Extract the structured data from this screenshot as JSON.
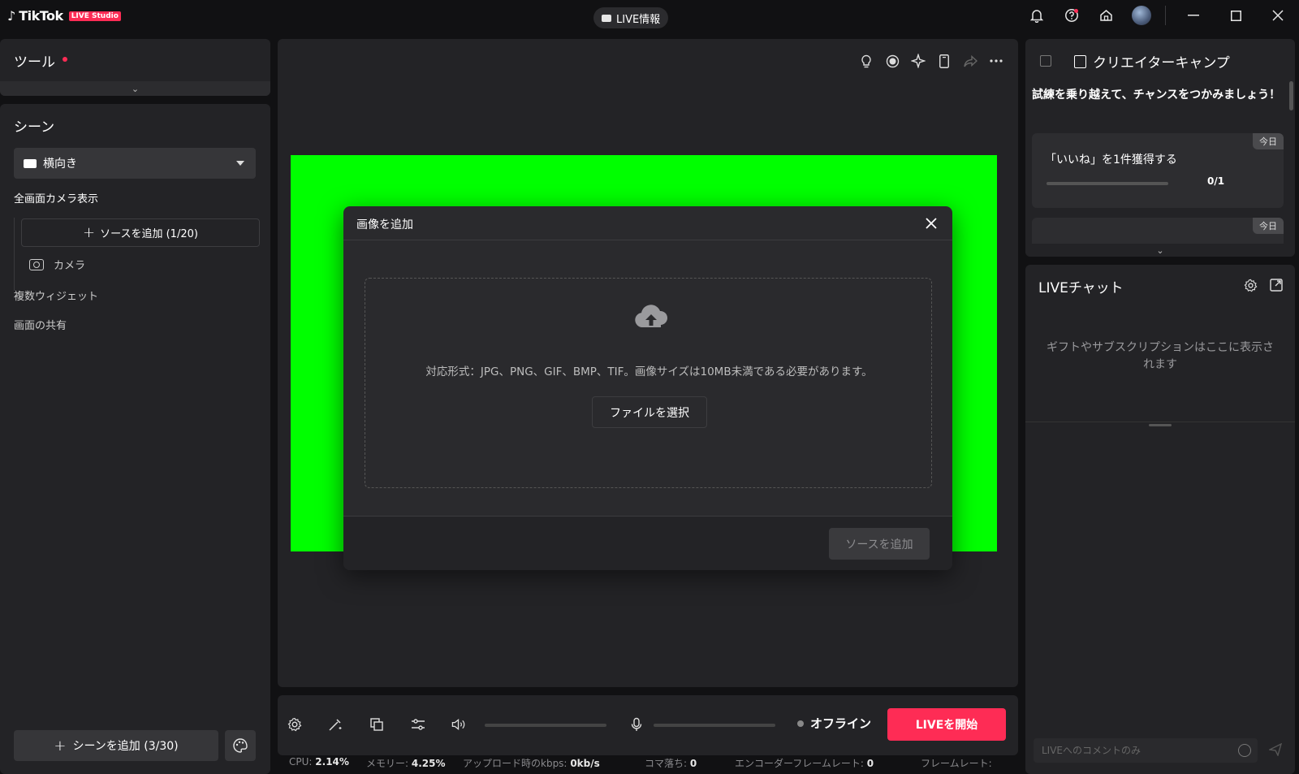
{
  "app": {
    "logo_text": "TikTok",
    "logo_badge": "LIVE Studio",
    "live_info_label": "LIVE情報"
  },
  "tools": {
    "title": "ツール"
  },
  "scenes": {
    "title": "シーン",
    "selected": "横向き",
    "group_label": "全画面カメラ表示",
    "add_source_label": "ソースを追加 (1/20)",
    "sources": [
      {
        "label": "カメラ",
        "icon": "camera-icon"
      }
    ],
    "links": [
      "複数ウィジェット",
      "画面の共有"
    ],
    "add_scene_label": "シーンを追加 (3/30)"
  },
  "preview": {
    "background_color": "#00ff00"
  },
  "controls": {
    "status_label": "オフライン",
    "go_live_label": "LIVEを開始"
  },
  "stats": [
    {
      "label": "CPU:",
      "value": "2.14%"
    },
    {
      "label": "メモリー:",
      "value": "4.25%"
    },
    {
      "label": "アップロード時のkbps:",
      "value": "0kb/s"
    },
    {
      "label": "コマ落ち:",
      "value": "0"
    },
    {
      "label": "エンコーダーフレームレート:",
      "value": "0"
    },
    {
      "label": "フレームレート:",
      "value": ""
    }
  ],
  "creator_camp": {
    "title": "クリエイターキャンプ",
    "subtitle": "試練を乗り越えて、チャンスをつかみましょう！",
    "tasks": [
      {
        "tag": "今日",
        "text": "「いいね」を1件獲得する",
        "progress_text": "0/1",
        "progress": 0
      },
      {
        "tag": "今日",
        "text": "",
        "progress_text": "",
        "progress": 0
      }
    ]
  },
  "chat": {
    "title": "LIVEチャット",
    "empty_text": "ギフトやサブスクリプションはここに表示されます",
    "input_placeholder": "LIVEへのコメントのみ"
  },
  "modal": {
    "title": "画像を追加",
    "supported_text": "対応形式：JPG、PNG、GIF、BMP、TIF。画像サイズは10MB未満である必要があります。",
    "select_file_label": "ファイルを選択",
    "add_source_label": "ソースを追加"
  },
  "colors": {
    "accent": "#fe2c55",
    "panel": "#232326",
    "background": "#111113"
  }
}
